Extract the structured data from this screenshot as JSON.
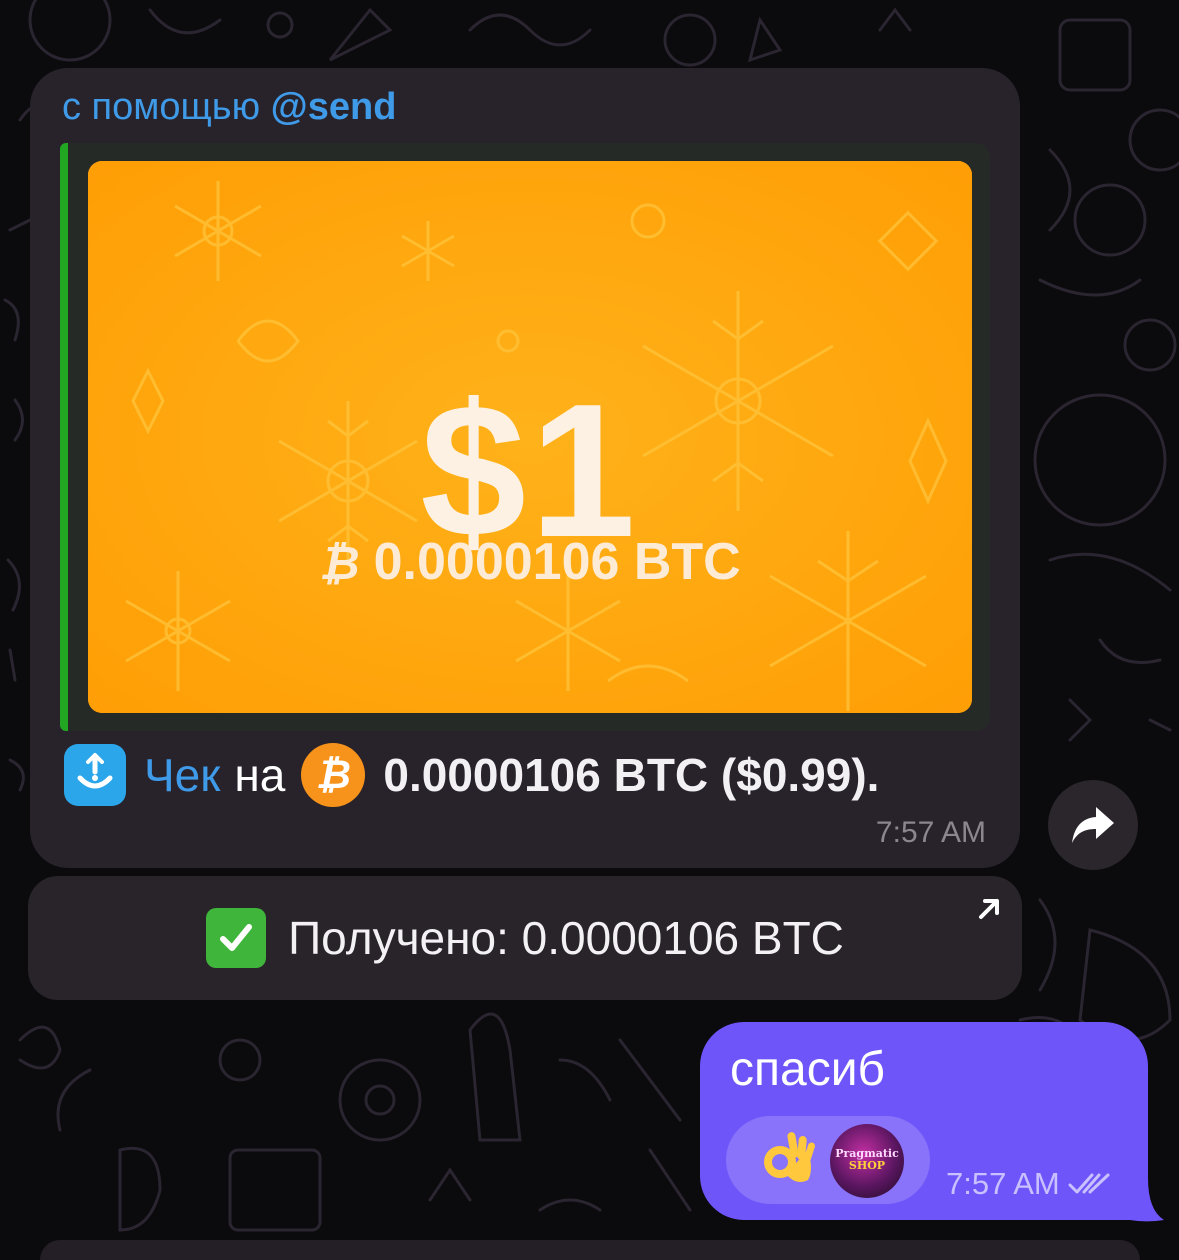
{
  "incoming_message": {
    "via_prefix": "с помощью",
    "via_handle": "@send",
    "card": {
      "amount": "$1",
      "btc_symbol": "₿",
      "btc_amount": "0.0000106 BTC"
    },
    "check_label": "Чек",
    "word_na": "на",
    "coin_symbol": "₿",
    "amount_text": "0.0000106 BTC ($0.99).",
    "time": "7:57 AM"
  },
  "inline_button": {
    "label": "Получено: 0.0000106 BTC"
  },
  "outgoing_message": {
    "text": "спасиб",
    "avatar_title": "Pragmatic",
    "avatar_subtitle": "SHOP",
    "time": "7:57 AM",
    "status": "read"
  },
  "colors": {
    "incoming_bubble": "#28222b",
    "outgoing_bubble": "#6e55f9",
    "link": "#3f9ae8",
    "card_orange": "#ffa90f",
    "preview_bar": "#22a722"
  },
  "icons": {
    "share": "share-arrow-icon",
    "open": "arrow-up-right-icon",
    "check": "check-mark-icon",
    "reaction": "ok-hand-emoji"
  }
}
